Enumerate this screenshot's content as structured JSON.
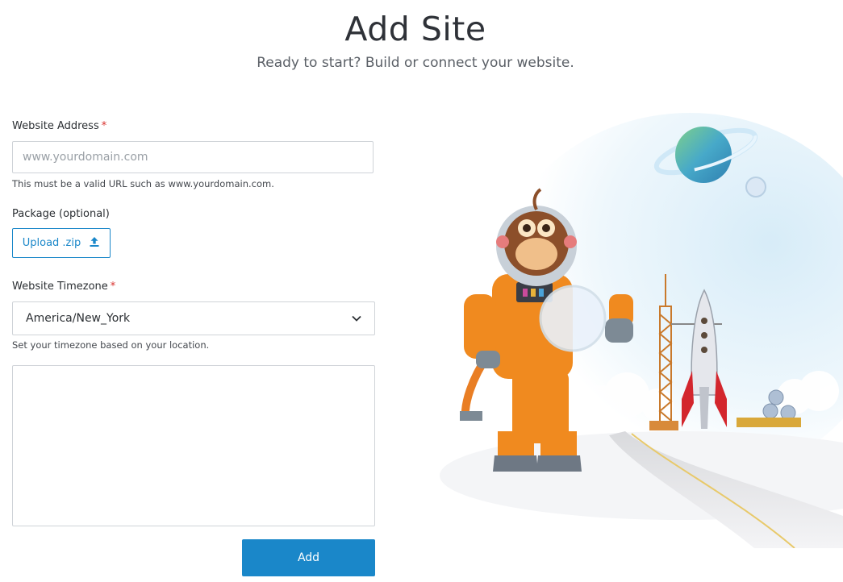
{
  "page": {
    "title": "Add Site",
    "subtitle": "Ready to start? Build or connect your website."
  },
  "form": {
    "website_address": {
      "label": "Website Address",
      "required_mark": "*",
      "placeholder": "www.yourdomain.com",
      "value": "",
      "hint": "This must be a valid URL such as www.yourdomain.com."
    },
    "package": {
      "label": "Package (optional)",
      "upload_label": "Upload .zip",
      "icon": "upload-icon"
    },
    "timezone": {
      "label": "Website Timezone",
      "required_mark": "*",
      "selected": "America/New_York",
      "icon": "chevron-down-icon",
      "hint": "Set your timezone based on your location."
    },
    "notes": {
      "value": ""
    },
    "submit_label": "Add"
  },
  "colors": {
    "accent": "#1a87c9",
    "required": "#d9302d",
    "border": "#cfd3d8",
    "text": "#2b2f33"
  }
}
